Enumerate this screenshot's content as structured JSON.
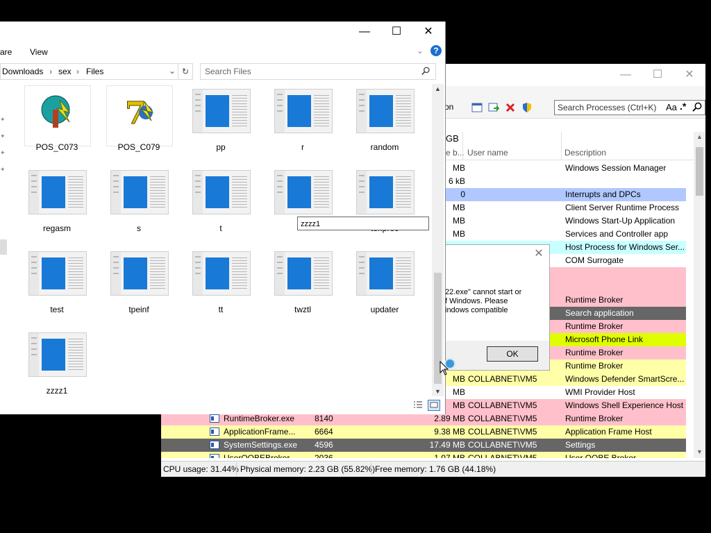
{
  "process_hacker": {
    "search_placeholder": "Search Processes (Ctrl+K)",
    "search_opt_aa": "Aa",
    "search_opt_regex": ".*",
    "toolbar_partial": "on",
    "header": {
      "col_partial": "GB",
      "col_partial2": "e b...",
      "col_user": "User name",
      "col_desc": "Description"
    },
    "rows": [
      {
        "mem": "MB",
        "user": "",
        "desc": "Windows Session Manager",
        "color": "white"
      },
      {
        "mem": "6 kB",
        "user": "",
        "desc": "",
        "color": "white"
      },
      {
        "mem": "0",
        "user": "",
        "desc": "Interrupts and DPCs",
        "color": "blue"
      },
      {
        "mem": "MB",
        "user": "",
        "desc": "Client Server Runtime Process",
        "color": "white"
      },
      {
        "mem": "MB",
        "user": "",
        "desc": "Windows Start-Up Application",
        "color": "white"
      },
      {
        "mem": "MB",
        "user": "",
        "desc": "Services and Controller app",
        "color": "white"
      },
      {
        "mem": "",
        "user": "",
        "desc": "Host Process for Windows Ser...",
        "color": "cyan"
      },
      {
        "mem": "",
        "user": "",
        "desc": "COM Surrogate",
        "color": "white"
      },
      {
        "mem": "",
        "user": "",
        "desc": "",
        "color": "pink"
      },
      {
        "mem": "",
        "user": "",
        "desc": "",
        "color": "pink"
      },
      {
        "mem": "",
        "user": "",
        "desc": "Runtime Broker",
        "color": "pink"
      },
      {
        "mem": "",
        "user": "",
        "desc": "Search application",
        "color": "dark"
      },
      {
        "mem": "",
        "user": "",
        "desc": "Runtime Broker",
        "color": "pink"
      },
      {
        "mem": "",
        "user": "",
        "desc": "Microsoft Phone Link",
        "color": "lime"
      },
      {
        "mem": "",
        "user": "",
        "desc": "Runtime Broker",
        "color": "pink"
      },
      {
        "mem": "",
        "user": "",
        "desc": "Runtime Broker",
        "color": "yellow"
      },
      {
        "mem": "MB",
        "user": "COLLABNET\\VM5",
        "desc": "Windows Defender SmartScre...",
        "color": "yellow"
      },
      {
        "mem": "MB",
        "user": "",
        "desc": "WMI Provider Host",
        "color": "white"
      },
      {
        "mem": "MB",
        "user": "COLLABNET\\VM5",
        "desc": "Windows Shell Experience Host",
        "color": "pink"
      }
    ],
    "full_rows": [
      {
        "name": "RuntimeBroker.exe",
        "pid": "8140",
        "mem": "2.89 MB",
        "user": "COLLABNET\\VM5",
        "desc": "Runtime Broker",
        "color": "pink"
      },
      {
        "name": "ApplicationFrame...",
        "pid": "6664",
        "mem": "9.38 MB",
        "user": "COLLABNET\\VM5",
        "desc": "Application Frame Host",
        "color": "yellow"
      },
      {
        "name": "SystemSettings.exe",
        "pid": "4596",
        "mem": "17.49 MB",
        "user": "COLLABNET\\VM5",
        "desc": "Settings",
        "color": "dark"
      },
      {
        "name": "UserOOBEBroker...",
        "pid": "2036",
        "mem": "1.07 MB",
        "user": "COLLABNET\\VM5",
        "desc": "User OOBE Broker",
        "color": "yellow"
      }
    ],
    "status": {
      "cpu": "CPU usage: 31.44%",
      "physical": "Physical memory: 2.23 GB (55.82%)",
      "free": "Free memory: 1.76 GB (44.18%)"
    }
  },
  "dialog": {
    "text_line1": "22.exe\" cannot start or",
    "text_line2": "f Windows. Please",
    "text_line3": "indows compatible",
    "ok_label": "OK"
  },
  "explorer": {
    "ribbon_partial": "are",
    "ribbon_view": "View",
    "breadcrumb": [
      "Downloads",
      "sex",
      "Files"
    ],
    "search_placeholder": "Search Files",
    "rename_value": "zzzz1",
    "files": [
      {
        "name": "POS_C073",
        "kind": "app1"
      },
      {
        "name": "POS_C079",
        "kind": "app2"
      },
      {
        "name": "pp",
        "kind": "doc"
      },
      {
        "name": "r",
        "kind": "doc"
      },
      {
        "name": "random",
        "kind": "doc"
      },
      {
        "name": "regasm",
        "kind": "doc"
      },
      {
        "name": "s",
        "kind": "doc"
      },
      {
        "name": "t",
        "kind": "doc"
      },
      {
        "name": "",
        "kind": "doc"
      },
      {
        "name": "ter.proc",
        "kind": "doc"
      },
      {
        "name": "test",
        "kind": "doc"
      },
      {
        "name": "tpeinf",
        "kind": "doc"
      },
      {
        "name": "tt",
        "kind": "doc"
      },
      {
        "name": "twztl",
        "kind": "doc"
      },
      {
        "name": "updater",
        "kind": "doc"
      },
      {
        "name": "zzzz1",
        "kind": "doc"
      }
    ]
  }
}
